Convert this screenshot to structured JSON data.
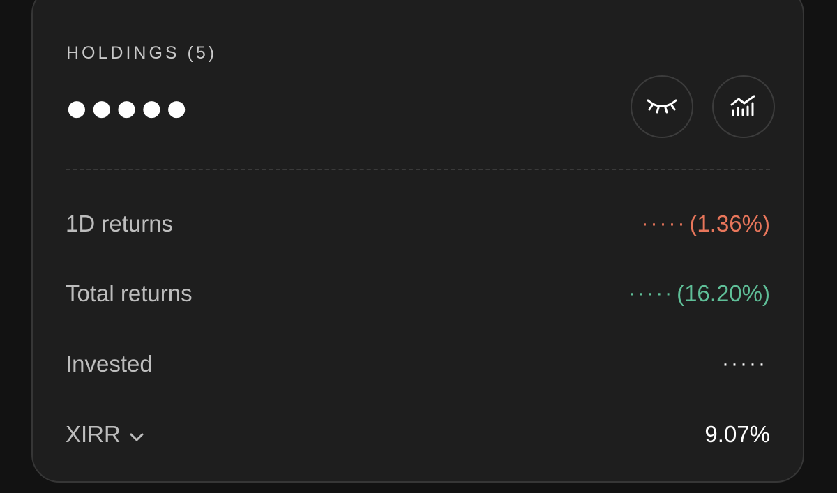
{
  "holdings": {
    "title": "HOLDINGS (5)",
    "masked_total": "●●●●●"
  },
  "buttons": {
    "hide_icon": "closed-eye-icon",
    "analytics_icon": "chart-trend-icon"
  },
  "rows": {
    "one_day": {
      "label": "1D returns",
      "masked": "·····",
      "percent": "(1.36%)",
      "color": "#e8765b"
    },
    "total": {
      "label": "Total returns",
      "masked": "·····",
      "percent": "(16.20%)",
      "color": "#5fbf98"
    },
    "invested": {
      "label": "Invested",
      "masked": "·····"
    },
    "xirr": {
      "label": "XIRR",
      "value": "9.07%",
      "dropdown_icon": "chevron-down-icon"
    }
  }
}
